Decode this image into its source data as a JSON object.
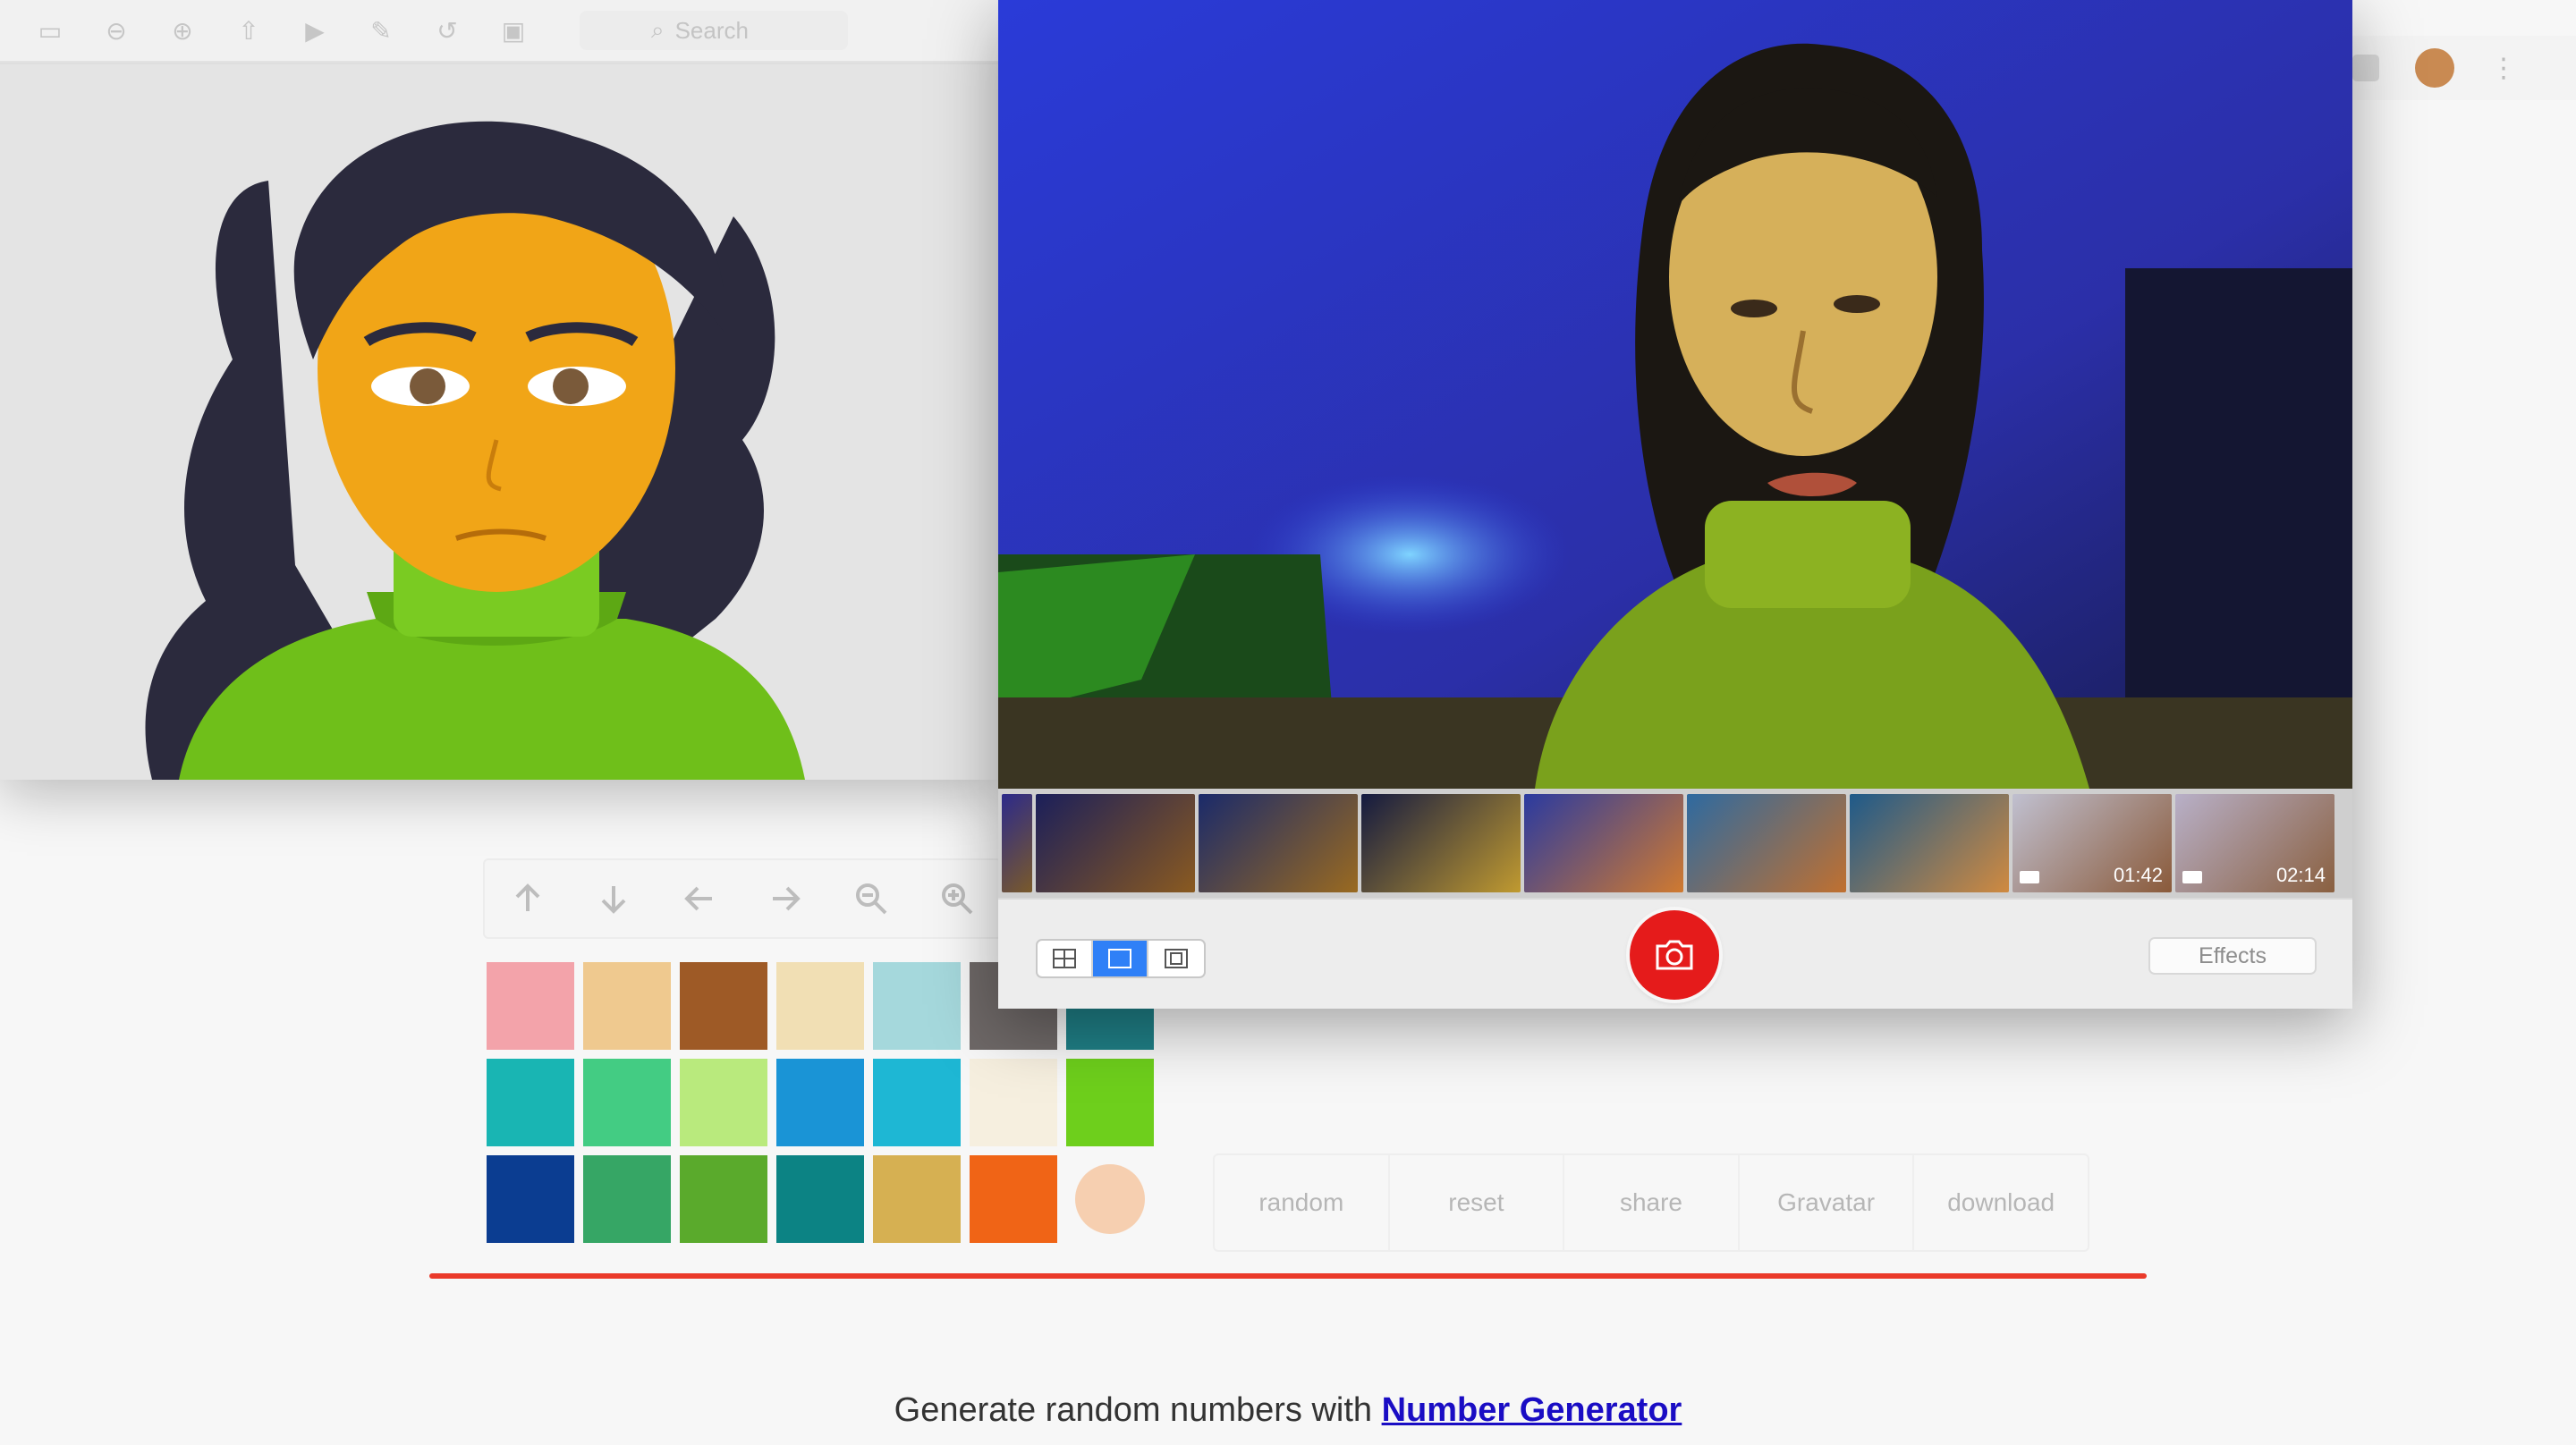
{
  "preview": {
    "search_placeholder": "Search"
  },
  "controls": {
    "buttons": [
      "arrow-up-icon",
      "arrow-down-icon",
      "arrow-left-icon",
      "arrow-right-icon",
      "zoom-out-icon",
      "zoom-in-icon"
    ]
  },
  "palette": {
    "colors": [
      "#f3a3aa",
      "#efc98f",
      "#9e5a26",
      "#f1dfb4",
      "#a5d8dc",
      "#6e6867",
      "#1f7f86",
      "#19b5b3",
      "#43cc83",
      "#b9ea7d",
      "#1a94d6",
      "#1eb7d4",
      "#f6efdf",
      "#6ecf1c",
      "#0b3d91",
      "#36a665",
      "#5aaa2c",
      "#0c8384",
      "#d6b052",
      "#f06416",
      "#f6cfb0"
    ]
  },
  "actions": {
    "random": "random",
    "reset": "reset",
    "share": "share",
    "gravatar": "Gravatar",
    "download": "download"
  },
  "footer": {
    "prefix": "Generate random numbers with ",
    "link": "Number Generator"
  },
  "booth": {
    "thumbnails": [
      {
        "duration": ""
      },
      {
        "duration": ""
      },
      {
        "duration": ""
      },
      {
        "duration": ""
      },
      {
        "duration": ""
      },
      {
        "duration": ""
      },
      {
        "duration": ""
      },
      {
        "duration": "01:42"
      },
      {
        "duration": "02:14"
      }
    ],
    "effects_label": "Effects"
  }
}
